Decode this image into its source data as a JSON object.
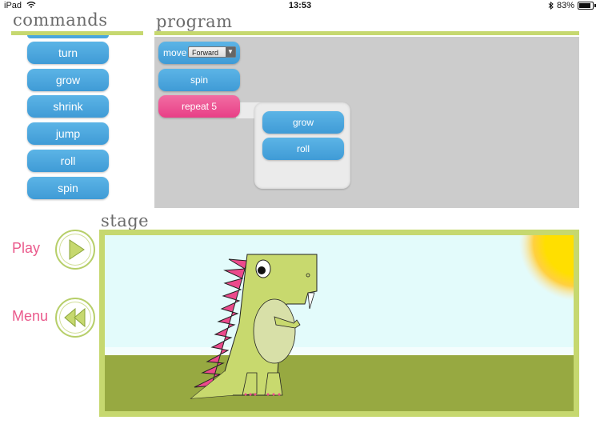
{
  "status_bar": {
    "device": "iPad",
    "wifi_icon": "wifi-icon",
    "time": "13:53",
    "bluetooth_icon": "bluetooth-icon",
    "battery": "83%"
  },
  "commands": {
    "title": "commands",
    "items": [
      "turn",
      "grow",
      "shrink",
      "jump",
      "roll",
      "spin"
    ]
  },
  "program": {
    "title": "program",
    "move_label": "move",
    "move_direction": "Forward",
    "spin_label": "spin",
    "repeat_label": "repeat 5",
    "repeat_children": [
      "grow",
      "roll"
    ]
  },
  "stage": {
    "title": "stage"
  },
  "controls": {
    "play_label": "Play",
    "menu_label": "Menu"
  },
  "colors": {
    "accent_lime": "#c6d86f",
    "command_blue": "#4aa7de",
    "repeat_pink": "#ec4a8c",
    "label_pink": "#ea5a8c",
    "sky": "#e3fbfb",
    "grass": "#97a941",
    "dino": "#c8d96e"
  }
}
